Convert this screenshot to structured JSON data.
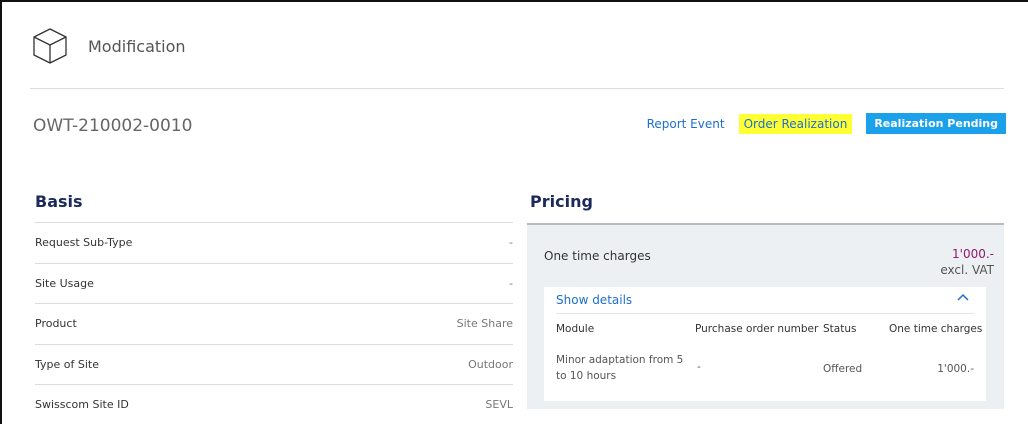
{
  "header": {
    "title": "Modification",
    "icon": "cube-icon"
  },
  "order": {
    "reference": "OWT-210002-0010"
  },
  "actions": {
    "report_event": "Report Event",
    "order_realization": "Order Realization",
    "status_badge": "Realization Pending",
    "highlight_color": "#ffff33",
    "badge_color": "#1aa1ea"
  },
  "basis": {
    "title": "Basis",
    "rows": [
      {
        "label": "Request Sub-Type",
        "value": "-"
      },
      {
        "label": "Site Usage",
        "value": "-"
      },
      {
        "label": "Product",
        "value": "Site Share"
      },
      {
        "label": "Type of Site",
        "value": "Outdoor"
      },
      {
        "label": "Swisscom Site ID",
        "value": "SEVL"
      }
    ]
  },
  "pricing": {
    "title": "Pricing",
    "one_time_charges_label": "One time charges",
    "one_time_charges_amount": "1'000.-",
    "vat_note": "excl. VAT",
    "amount_color": "#8e1c6c",
    "show_details": "Show details",
    "table": {
      "headers": [
        "Module",
        "Purchase order number",
        "Status",
        "One time charges"
      ],
      "rows": [
        {
          "module_line1": "Minor adaptation from 5",
          "module_line2": "to 10 hours",
          "po_number": "-",
          "status": "Offered",
          "charges": "1'000.-"
        }
      ]
    }
  }
}
